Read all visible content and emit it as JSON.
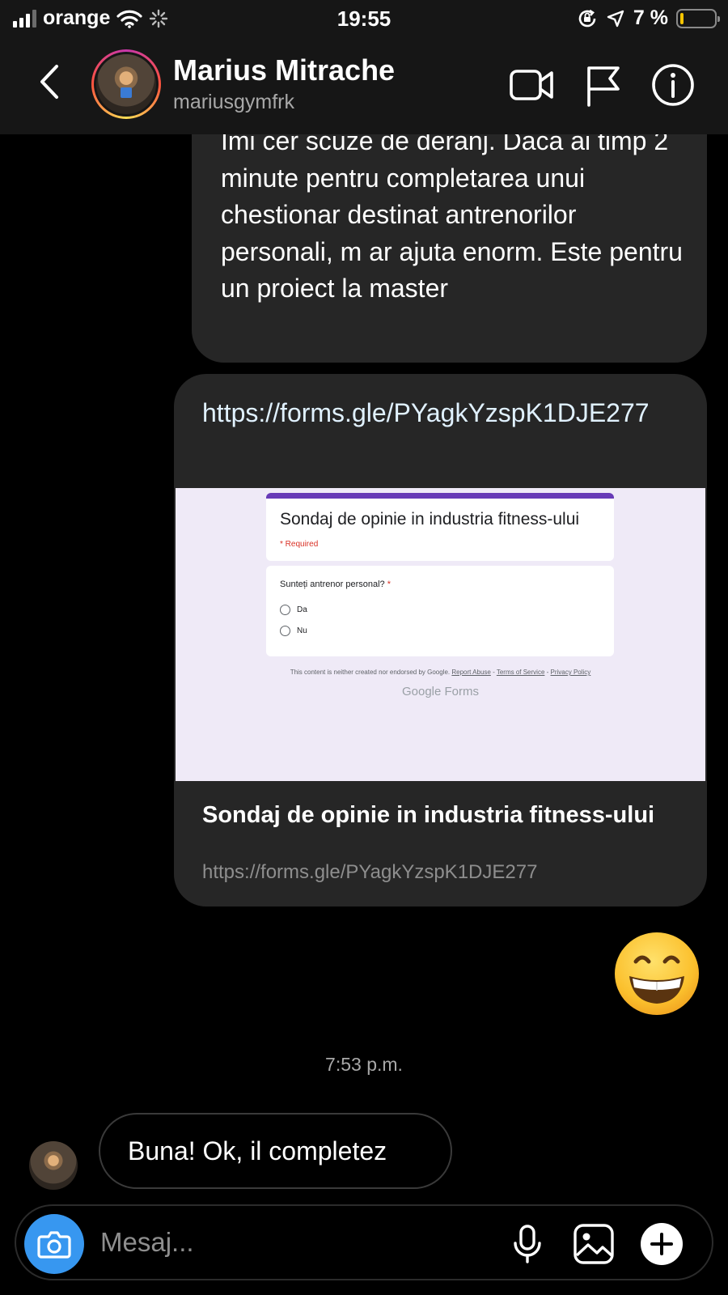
{
  "status_bar": {
    "carrier": "orange",
    "time": "19:55",
    "battery_text": "7 %",
    "battery_level": 0.07
  },
  "header": {
    "name": "Marius Mitrache",
    "username": "mariusgymfrk",
    "icons": [
      "back-icon",
      "video-call-icon",
      "flag-icon",
      "info-icon"
    ]
  },
  "messages": {
    "outgoing_text": "Îmi cer scuze de deranj. Daca ai timp 2 minute pentru completarea unui chestionar destinat antrenorilor personali, m ar ajuta enorm. Este pentru un proiect la master",
    "link_url": "https://forms.gle/PYagkYzspK1DJE277",
    "link_preview": {
      "form_title": "Sondaj de opinie in industria fitness-ului",
      "required_note": "* Required",
      "question": "Sunteți antrenor personal?",
      "question_star": "*",
      "options": [
        "Da",
        "Nu"
      ],
      "footer_prefix": "This content is neither created nor endorsed by Google.",
      "footer_links": [
        "Report Abuse",
        "Terms of Service",
        "Privacy Policy"
      ],
      "brand_google": "Google",
      "brand_forms": "Forms"
    },
    "link_title": "Sondaj de opinie in industria fitness-ului",
    "link_url_display": "https://forms.gle/PYagkYzspK1DJE277",
    "emoji": "😁",
    "timestamp": "7:53 p.m.",
    "incoming_text": "Buna! Ok, il completez"
  },
  "composer": {
    "placeholder": "Mesaj...",
    "icons": [
      "camera-icon",
      "microphone-icon",
      "gallery-icon",
      "add-icon"
    ]
  },
  "colors": {
    "accent_blue": "#3797f0",
    "bubble_bg": "#262626",
    "form_purple": "#673ab7"
  }
}
